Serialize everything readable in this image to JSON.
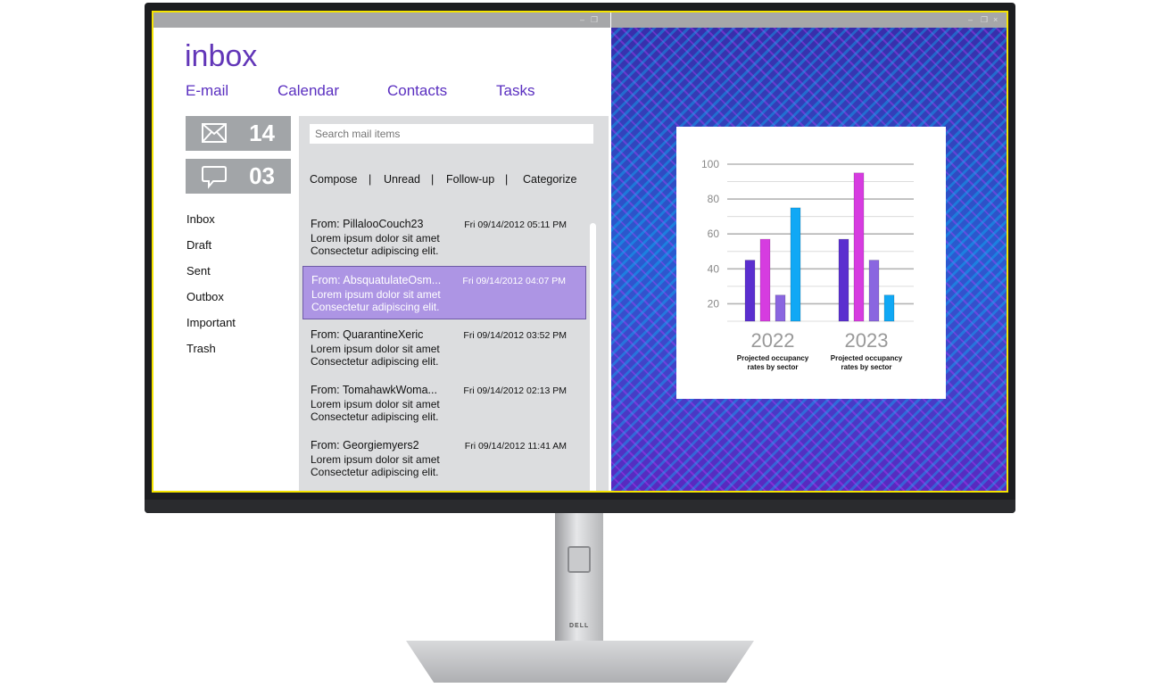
{
  "app": {
    "title": "inbox",
    "tabs": [
      "E-mail",
      "Calendar",
      "Contacts",
      "Tasks"
    ],
    "counters": [
      {
        "icon": "envelope-icon",
        "value": "14"
      },
      {
        "icon": "chat-bubble-icon",
        "value": "03"
      }
    ],
    "folders": [
      "Inbox",
      "Draft",
      "Sent",
      "Outbox",
      "Important",
      "Trash"
    ],
    "search": {
      "placeholder": "Search mail items"
    },
    "actions": [
      "Compose",
      "Unread",
      "Follow-up",
      "Categorize"
    ],
    "separator": "|",
    "mails": [
      {
        "from": "From: PillalooCouch23",
        "date": "Fri 09/14/2012 05:11 PM",
        "line1": "Lorem ipsum dolor sit amet",
        "line2": "Consectetur adipiscing elit.",
        "selected": false
      },
      {
        "from": "From: AbsquatulateOsm...",
        "date": "Fri 09/14/2012 04:07 PM",
        "line1": "Lorem ipsum dolor sit amet",
        "line2": "Consectetur adipiscing elit.",
        "selected": true
      },
      {
        "from": "From: QuarantineXeric",
        "date": "Fri 09/14/2012 03:52 PM",
        "line1": "Lorem ipsum dolor sit amet",
        "line2": "Consectetur adipiscing elit.",
        "selected": false
      },
      {
        "from": "From: TomahawkWoma...",
        "date": "Fri 09/14/2012 02:13 PM",
        "line1": "Lorem ipsum dolor sit amet",
        "line2": "Consectetur adipiscing elit.",
        "selected": false
      },
      {
        "from": "From: Georgiemyers2",
        "date": "Fri 09/14/2012 11:41 AM",
        "line1": "Lorem ipsum dolor sit amet",
        "line2": "Consectetur adipiscing elit.",
        "selected": false
      }
    ],
    "colors": {
      "accent": "#5a2fc0",
      "selected": "#ad95e4"
    }
  },
  "monitor": {
    "brand_logo": "DELL"
  },
  "chart_data": {
    "type": "bar",
    "categories": [
      "2022",
      "2023"
    ],
    "subtitles": [
      "Projected occupancy rates by sector",
      "Projected occupancy rates by sector"
    ],
    "yticks": [
      20,
      40,
      60,
      80,
      100
    ],
    "ylim": [
      10,
      100
    ],
    "grid": true,
    "series": [
      {
        "color": "#5b2fcf",
        "values": [
          45,
          57
        ]
      },
      {
        "color": "#d63ce0",
        "values": [
          57,
          95
        ]
      },
      {
        "color": "#8a66e0",
        "values": [
          25,
          45
        ]
      },
      {
        "color": "#10a8f5",
        "values": [
          75,
          25
        ]
      }
    ]
  }
}
